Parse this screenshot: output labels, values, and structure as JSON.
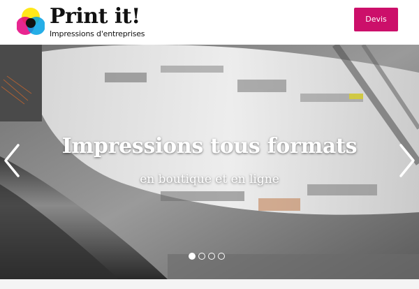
{
  "header": {
    "brand_name": "Print it!",
    "brand_tagline": "Impressions d'entreprises",
    "cta_label": "Devis",
    "cta_color": "#cc0f6a",
    "logo_colors": [
      "#ffe600",
      "#e4007c",
      "#00a0e3"
    ]
  },
  "hero": {
    "title": "Impressions tous formats",
    "subtitle": "en boutique et en ligne",
    "prev_icon": "chevron-left-icon",
    "next_icon": "chevron-right-icon",
    "slides_count": 4,
    "active_slide": 1
  }
}
